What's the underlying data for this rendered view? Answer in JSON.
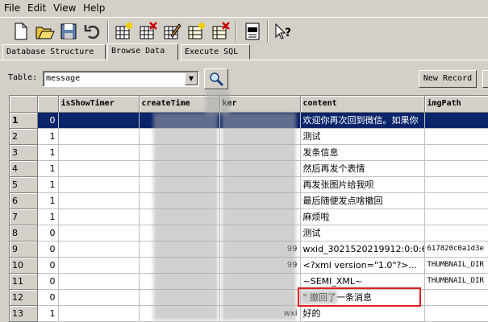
{
  "menu": [
    "File",
    "Edit",
    "View",
    "Help"
  ],
  "toolbar": {
    "buttons": [
      "new-database-icon",
      "open-database-icon",
      "save-icon",
      "undo-icon",
      "create-table-icon",
      "delete-table-icon",
      "modify-table-icon",
      "create-index-icon",
      "delete-index-icon",
      "log-icon",
      "whats-this-help-icon"
    ]
  },
  "tabs": [
    {
      "label": "Database Structure",
      "active": false
    },
    {
      "label": "Browse Data",
      "active": true
    },
    {
      "label": "Execute SQL",
      "active": false
    }
  ],
  "browse": {
    "table_label": "Table:",
    "table_value": "message",
    "new_record_label": "New Record"
  },
  "grid": {
    "columns": [
      "",
      "",
      "isShowTimer",
      "createTime",
      "ker",
      "content",
      "imgPath"
    ],
    "rows": [
      {
        "n": "1",
        "a": "0",
        "b": "",
        "c": "",
        "d": "",
        "content": "欢迎你再次回到微信。如果你",
        "img": ""
      },
      {
        "n": "2",
        "a": "1",
        "b": "",
        "c": "",
        "d": "",
        "content": "测试",
        "img": ""
      },
      {
        "n": "3",
        "a": "1",
        "b": "",
        "c": "",
        "d": "",
        "content": "发条信息",
        "img": ""
      },
      {
        "n": "4",
        "a": "1",
        "b": "",
        "c": "",
        "d": "",
        "content": "然后再发个表情",
        "img": ""
      },
      {
        "n": "5",
        "a": "1",
        "b": "",
        "c": "",
        "d": "",
        "content": "再发张图片给我呗",
        "img": ""
      },
      {
        "n": "6",
        "a": "1",
        "b": "",
        "c": "",
        "d": "",
        "content": "最后随便发点啥撤回",
        "img": ""
      },
      {
        "n": "7",
        "a": "1",
        "b": "",
        "c": "",
        "d": "",
        "content": "麻烦啦",
        "img": ""
      },
      {
        "n": "8",
        "a": "0",
        "b": "",
        "c": "",
        "d": "",
        "content": "测试",
        "img": ""
      },
      {
        "n": "9",
        "a": "0",
        "b": "",
        "c": "",
        "d": "99",
        "content": "wxid_3021520219912:0:0:61",
        "img": "617820c0a1d3e"
      },
      {
        "n": "10",
        "a": "0",
        "b": "",
        "c": "",
        "d": "99",
        "content": "<?xml version=\"1.0\"?>...",
        "img": "THUMBNAIL_DIR"
      },
      {
        "n": "11",
        "a": "0",
        "b": "",
        "c": "",
        "d": "",
        "content": "~SEMI_XML~",
        "img": "THUMBNAIL_DIR"
      },
      {
        "n": "12",
        "a": "0",
        "b": "",
        "c": "",
        "d": "",
        "content": "\" 撤回了一条消息",
        "img": ""
      },
      {
        "n": "13",
        "a": "1",
        "b": "",
        "c": "20",
        "d": "wxi",
        "content": "好的",
        "img": ""
      }
    ]
  },
  "colors": {
    "selection": "#0a246a",
    "highlight_border": "#e02020",
    "chrome": "#d4d0c8"
  }
}
